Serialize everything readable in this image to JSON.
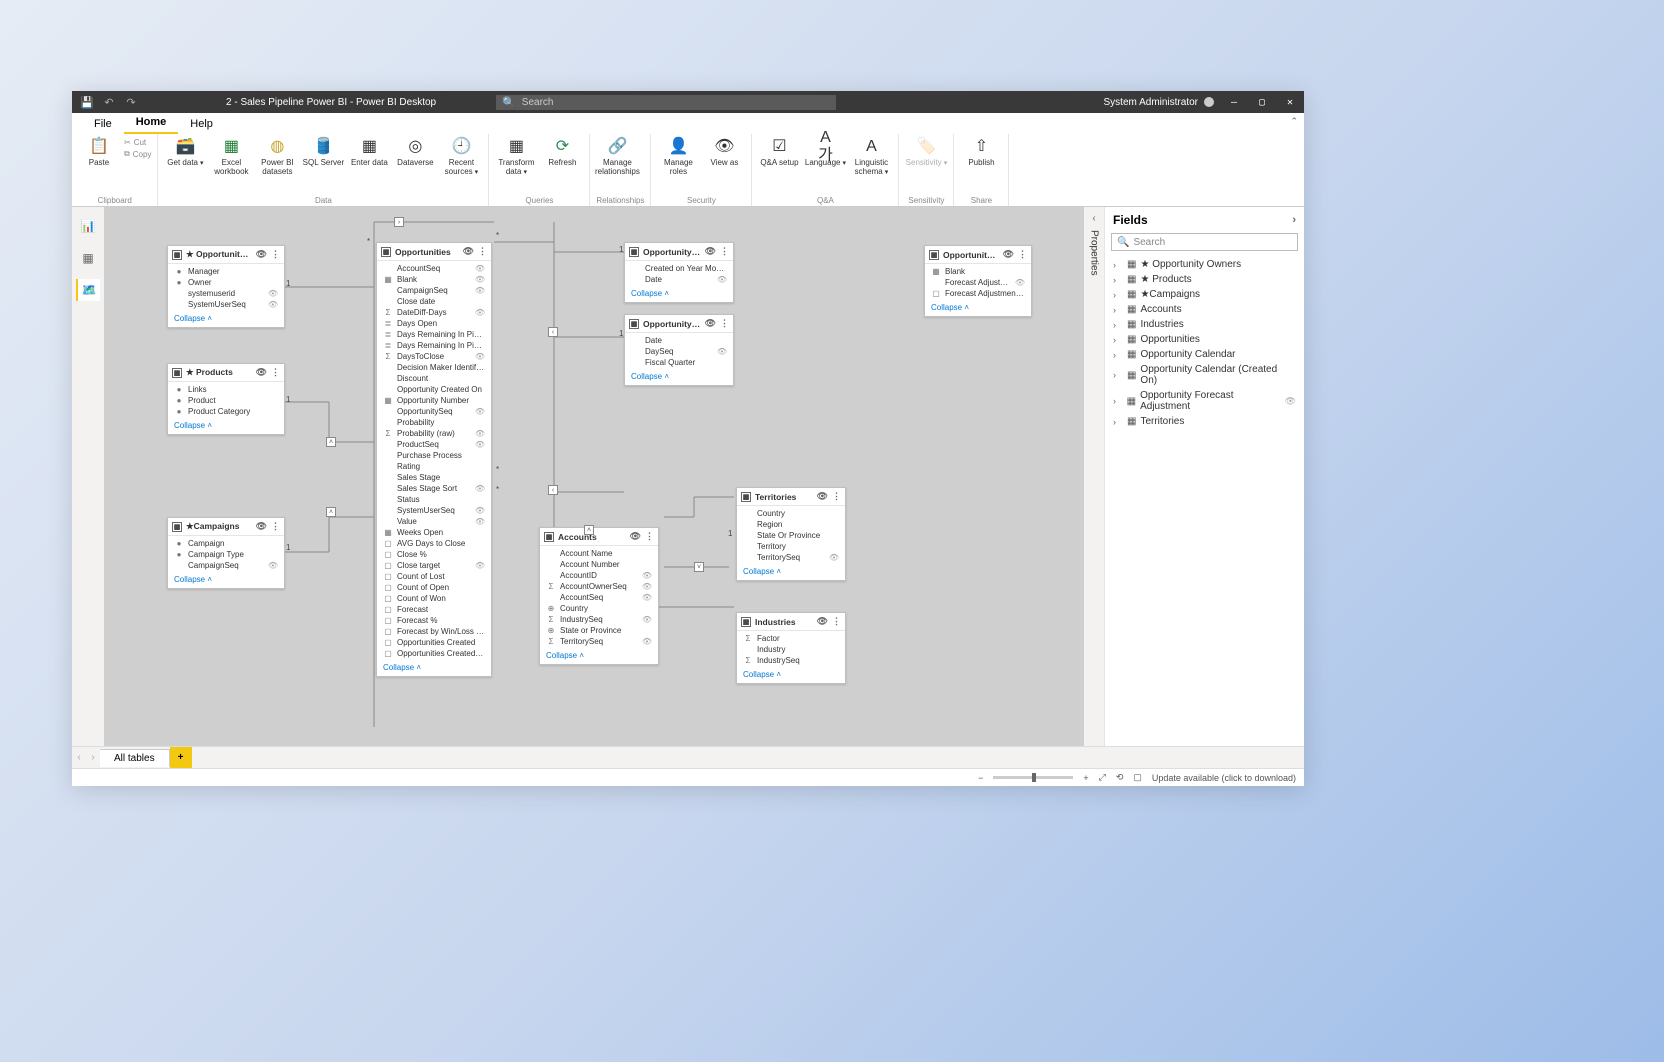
{
  "titleBar": {
    "docTitle": "2 - Sales Pipeline Power BI - Power BI Desktop",
    "searchPlaceholder": "Search",
    "userName": "System Administrator"
  },
  "ribbonTabs": [
    "File",
    "Home",
    "Help"
  ],
  "ribbon": {
    "clipboard": {
      "name": "Clipboard",
      "paste": "Paste",
      "cut": "Cut",
      "copy": "Copy"
    },
    "data": {
      "name": "Data",
      "getData": "Get data",
      "excel": "Excel workbook",
      "pbi": "Power BI datasets",
      "sql": "SQL Server",
      "enter": "Enter data",
      "dataverse": "Dataverse",
      "recent": "Recent sources"
    },
    "queries": {
      "name": "Queries",
      "transform": "Transform data",
      "refresh": "Refresh"
    },
    "relationships": {
      "name": "Relationships",
      "manageRel": "Manage relationships"
    },
    "security": {
      "name": "Security",
      "manageRoles": "Manage roles",
      "viewAs": "View as"
    },
    "qa": {
      "name": "Q&A",
      "qaSetup": "Q&A setup",
      "language": "Language",
      "linguistic": "Linguistic schema"
    },
    "sensitivity": {
      "name": "Sensitivity",
      "sensitivity": "Sensitivity"
    },
    "share": {
      "name": "Share",
      "publish": "Publish"
    }
  },
  "tables": {
    "oppOwners": {
      "title": "★ Opportunity Owners",
      "fields": [
        {
          "name": "Manager",
          "icon": "●",
          "hidden": false
        },
        {
          "name": "Owner",
          "icon": "●",
          "hidden": false
        },
        {
          "name": "systemuserid",
          "icon": "",
          "hidden": true
        },
        {
          "name": "SystemUserSeq",
          "icon": "",
          "hidden": true
        }
      ]
    },
    "products": {
      "title": "★ Products",
      "fields": [
        {
          "name": "Links",
          "icon": "●",
          "hidden": false
        },
        {
          "name": "Product",
          "icon": "●",
          "hidden": false
        },
        {
          "name": "Product Category",
          "icon": "●",
          "hidden": false
        }
      ]
    },
    "campaigns": {
      "title": "★Campaigns",
      "fields": [
        {
          "name": "Campaign",
          "icon": "●",
          "hidden": false
        },
        {
          "name": "Campaign Type",
          "icon": "●",
          "hidden": false
        },
        {
          "name": "CampaignSeq",
          "icon": "",
          "hidden": true
        }
      ]
    },
    "opportunities": {
      "title": "Opportunities",
      "fields": [
        {
          "name": "AccountSeq",
          "icon": "",
          "hidden": true
        },
        {
          "name": "Blank",
          "icon": "▦",
          "hidden": true
        },
        {
          "name": "CampaignSeq",
          "icon": "",
          "hidden": true
        },
        {
          "name": "Close date",
          "icon": "",
          "hidden": false
        },
        {
          "name": "DateDiff-Days",
          "icon": "Σ",
          "hidden": true
        },
        {
          "name": "Days Open",
          "icon": "≣",
          "hidden": false
        },
        {
          "name": "Days Remaining In Pipeline",
          "icon": "≣",
          "hidden": false
        },
        {
          "name": "Days Remaining In Pipeline (bi…",
          "icon": "≣",
          "hidden": false
        },
        {
          "name": "DaysToClose",
          "icon": "Σ",
          "hidden": true
        },
        {
          "name": "Decision Maker Identified",
          "icon": "",
          "hidden": false
        },
        {
          "name": "Discount",
          "icon": "",
          "hidden": false
        },
        {
          "name": "Opportunity Created On",
          "icon": "",
          "hidden": false
        },
        {
          "name": "Opportunity Number",
          "icon": "▦",
          "hidden": false
        },
        {
          "name": "OpportunitySeq",
          "icon": "",
          "hidden": true
        },
        {
          "name": "Probability",
          "icon": "",
          "hidden": false
        },
        {
          "name": "Probability (raw)",
          "icon": "Σ",
          "hidden": true
        },
        {
          "name": "ProductSeq",
          "icon": "",
          "hidden": true
        },
        {
          "name": "Purchase Process",
          "icon": "",
          "hidden": false
        },
        {
          "name": "Rating",
          "icon": "",
          "hidden": false
        },
        {
          "name": "Sales Stage",
          "icon": "",
          "hidden": false
        },
        {
          "name": "Sales Stage Sort",
          "icon": "",
          "hidden": true
        },
        {
          "name": "Status",
          "icon": "",
          "hidden": false
        },
        {
          "name": "SystemUserSeq",
          "icon": "",
          "hidden": true
        },
        {
          "name": "Value",
          "icon": "",
          "hidden": true
        },
        {
          "name": "Weeks Open",
          "icon": "▦",
          "hidden": false
        },
        {
          "name": "AVG Days to Close",
          "icon": "▢",
          "hidden": false
        },
        {
          "name": "Close %",
          "icon": "▢",
          "hidden": false
        },
        {
          "name": "Close target",
          "icon": "▢",
          "hidden": true
        },
        {
          "name": "Count of Lost",
          "icon": "▢",
          "hidden": false
        },
        {
          "name": "Count of Open",
          "icon": "▢",
          "hidden": false
        },
        {
          "name": "Count of Won",
          "icon": "▢",
          "hidden": false
        },
        {
          "name": "Forecast",
          "icon": "▢",
          "hidden": false
        },
        {
          "name": "Forecast %",
          "icon": "▢",
          "hidden": false
        },
        {
          "name": "Forecast by Win/Loss Ratio",
          "icon": "▢",
          "hidden": false
        },
        {
          "name": "Opportunities Created",
          "icon": "▢",
          "hidden": false
        },
        {
          "name": "Opportunities Created - MoM …",
          "icon": "▢",
          "hidden": false
        }
      ]
    },
    "oppCalCreated": {
      "title": "Opportunity Calenda…",
      "fields": [
        {
          "name": "Created on Year Month",
          "icon": "",
          "hidden": false
        },
        {
          "name": "Date",
          "icon": "",
          "hidden": true
        }
      ]
    },
    "oppCal": {
      "title": "Opportunity Calendar",
      "fields": [
        {
          "name": "Date",
          "icon": "",
          "hidden": false
        },
        {
          "name": "DaySeq",
          "icon": "",
          "hidden": true
        },
        {
          "name": "Fiscal Quarter",
          "icon": "",
          "hidden": false
        }
      ]
    },
    "forecastAdj": {
      "title": "Opportunity Forecast…",
      "fields": [
        {
          "name": "Blank",
          "icon": "▦",
          "hidden": false
        },
        {
          "name": "Forecast Adjustment",
          "icon": "",
          "hidden": true
        },
        {
          "name": "Forecast Adjustment Va…",
          "icon": "▢",
          "hidden": false
        }
      ]
    },
    "accounts": {
      "title": "Accounts",
      "fields": [
        {
          "name": "Account Name",
          "icon": "",
          "hidden": false
        },
        {
          "name": "Account Number",
          "icon": "",
          "hidden": false
        },
        {
          "name": "AccountID",
          "icon": "",
          "hidden": true
        },
        {
          "name": "AccountOwnerSeq",
          "icon": "Σ",
          "hidden": true
        },
        {
          "name": "AccountSeq",
          "icon": "",
          "hidden": true
        },
        {
          "name": "Country",
          "icon": "⊕",
          "hidden": false
        },
        {
          "name": "IndustrySeq",
          "icon": "Σ",
          "hidden": true
        },
        {
          "name": "State or Province",
          "icon": "⊕",
          "hidden": false
        },
        {
          "name": "TerritorySeq",
          "icon": "Σ",
          "hidden": true
        }
      ]
    },
    "territories": {
      "title": "Territories",
      "fields": [
        {
          "name": "Country",
          "icon": "",
          "hidden": false
        },
        {
          "name": "Region",
          "icon": "",
          "hidden": false
        },
        {
          "name": "State Or Province",
          "icon": "",
          "hidden": false
        },
        {
          "name": "Territory",
          "icon": "",
          "hidden": false
        },
        {
          "name": "TerritorySeq",
          "icon": "",
          "hidden": true
        }
      ]
    },
    "industries": {
      "title": "Industries",
      "fields": [
        {
          "name": "Factor",
          "icon": "Σ",
          "hidden": false
        },
        {
          "name": "Industry",
          "icon": "",
          "hidden": false
        },
        {
          "name": "IndustrySeq",
          "icon": "Σ",
          "hidden": false
        }
      ]
    }
  },
  "collapseLabel": "Collapse",
  "propertiesLabel": "Properties",
  "fieldsPane": {
    "title": "Fields",
    "searchPlaceholder": "Search",
    "items": [
      {
        "label": "★ Opportunity Owners",
        "hidden": false
      },
      {
        "label": "★ Products",
        "hidden": false
      },
      {
        "label": "★Campaigns",
        "hidden": false
      },
      {
        "label": "Accounts",
        "hidden": false
      },
      {
        "label": "Industries",
        "hidden": false
      },
      {
        "label": "Opportunities",
        "hidden": false
      },
      {
        "label": "Opportunity Calendar",
        "hidden": false
      },
      {
        "label": "Opportunity Calendar (Created On)",
        "hidden": false
      },
      {
        "label": "Opportunity Forecast Adjustment",
        "hidden": true
      },
      {
        "label": "Territories",
        "hidden": false
      }
    ]
  },
  "bottomTabs": {
    "allTables": "All tables"
  },
  "statusBar": {
    "update": "Update available (click to download)"
  }
}
